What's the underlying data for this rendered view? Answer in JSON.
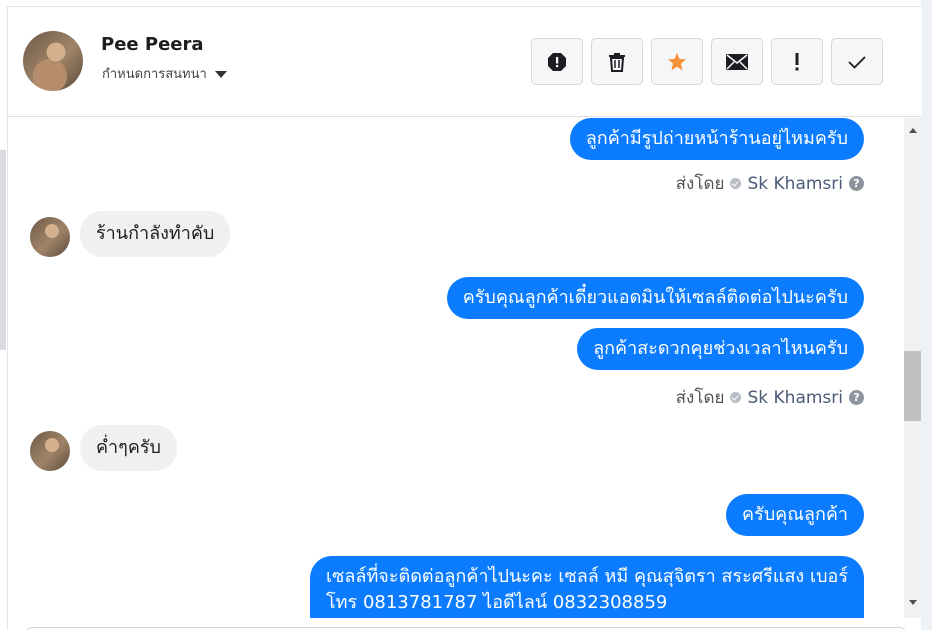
{
  "header": {
    "user_name": "Pee Peera",
    "conversation_setting": "กำหนดการสนทนา"
  },
  "toolbar": {
    "buttons": [
      {
        "name": "spam",
        "icon": "alert-octagon-icon"
      },
      {
        "name": "delete",
        "icon": "trash-icon"
      },
      {
        "name": "star",
        "icon": "star-icon",
        "color": "#f7923b"
      },
      {
        "name": "email",
        "icon": "envelope-icon"
      },
      {
        "name": "follow-up",
        "icon": "exclamation-icon"
      },
      {
        "name": "done",
        "icon": "checkmark-icon"
      }
    ]
  },
  "messages": [
    {
      "direction": "outgoing",
      "text": "ลูกค้ามีรูปถ่ายหน้าร้านอยู่ไหมครับ"
    },
    {
      "direction": "outgoing-meta",
      "label": "ส่งโดย",
      "agent": "Sk Khamsri"
    },
    {
      "direction": "incoming",
      "text": "ร้านกำลังทำคับ"
    },
    {
      "direction": "outgoing",
      "text": "ครับคุณลูกค้าเดี๋ยวแอดมินให้เซลล์ติดต่อไปนะครับ"
    },
    {
      "direction": "outgoing",
      "text": "ลูกค้าสะดวกคุยช่วงเวลาไหนครับ"
    },
    {
      "direction": "outgoing-meta",
      "label": "ส่งโดย",
      "agent": "Sk Khamsri"
    },
    {
      "direction": "incoming",
      "text": "ค่ำๆครับ"
    },
    {
      "direction": "outgoing",
      "text": "ครับคุณลูกค้า"
    },
    {
      "direction": "outgoing",
      "text": "เซลล์ที่จะติดต่อลูกค้าไปนะคะ เซลล์ หมี คุณสุจิตรา สระศรีแสง เบอร์"
    },
    {
      "direction": "outgoing",
      "text": "โทร 0813781787 ไอดีไลน์ 0832308859"
    }
  ],
  "colors": {
    "outgoing_bubble": "#0b7cff",
    "incoming_bubble": "#f0f0f0",
    "agent_name": "#4b5a78"
  }
}
